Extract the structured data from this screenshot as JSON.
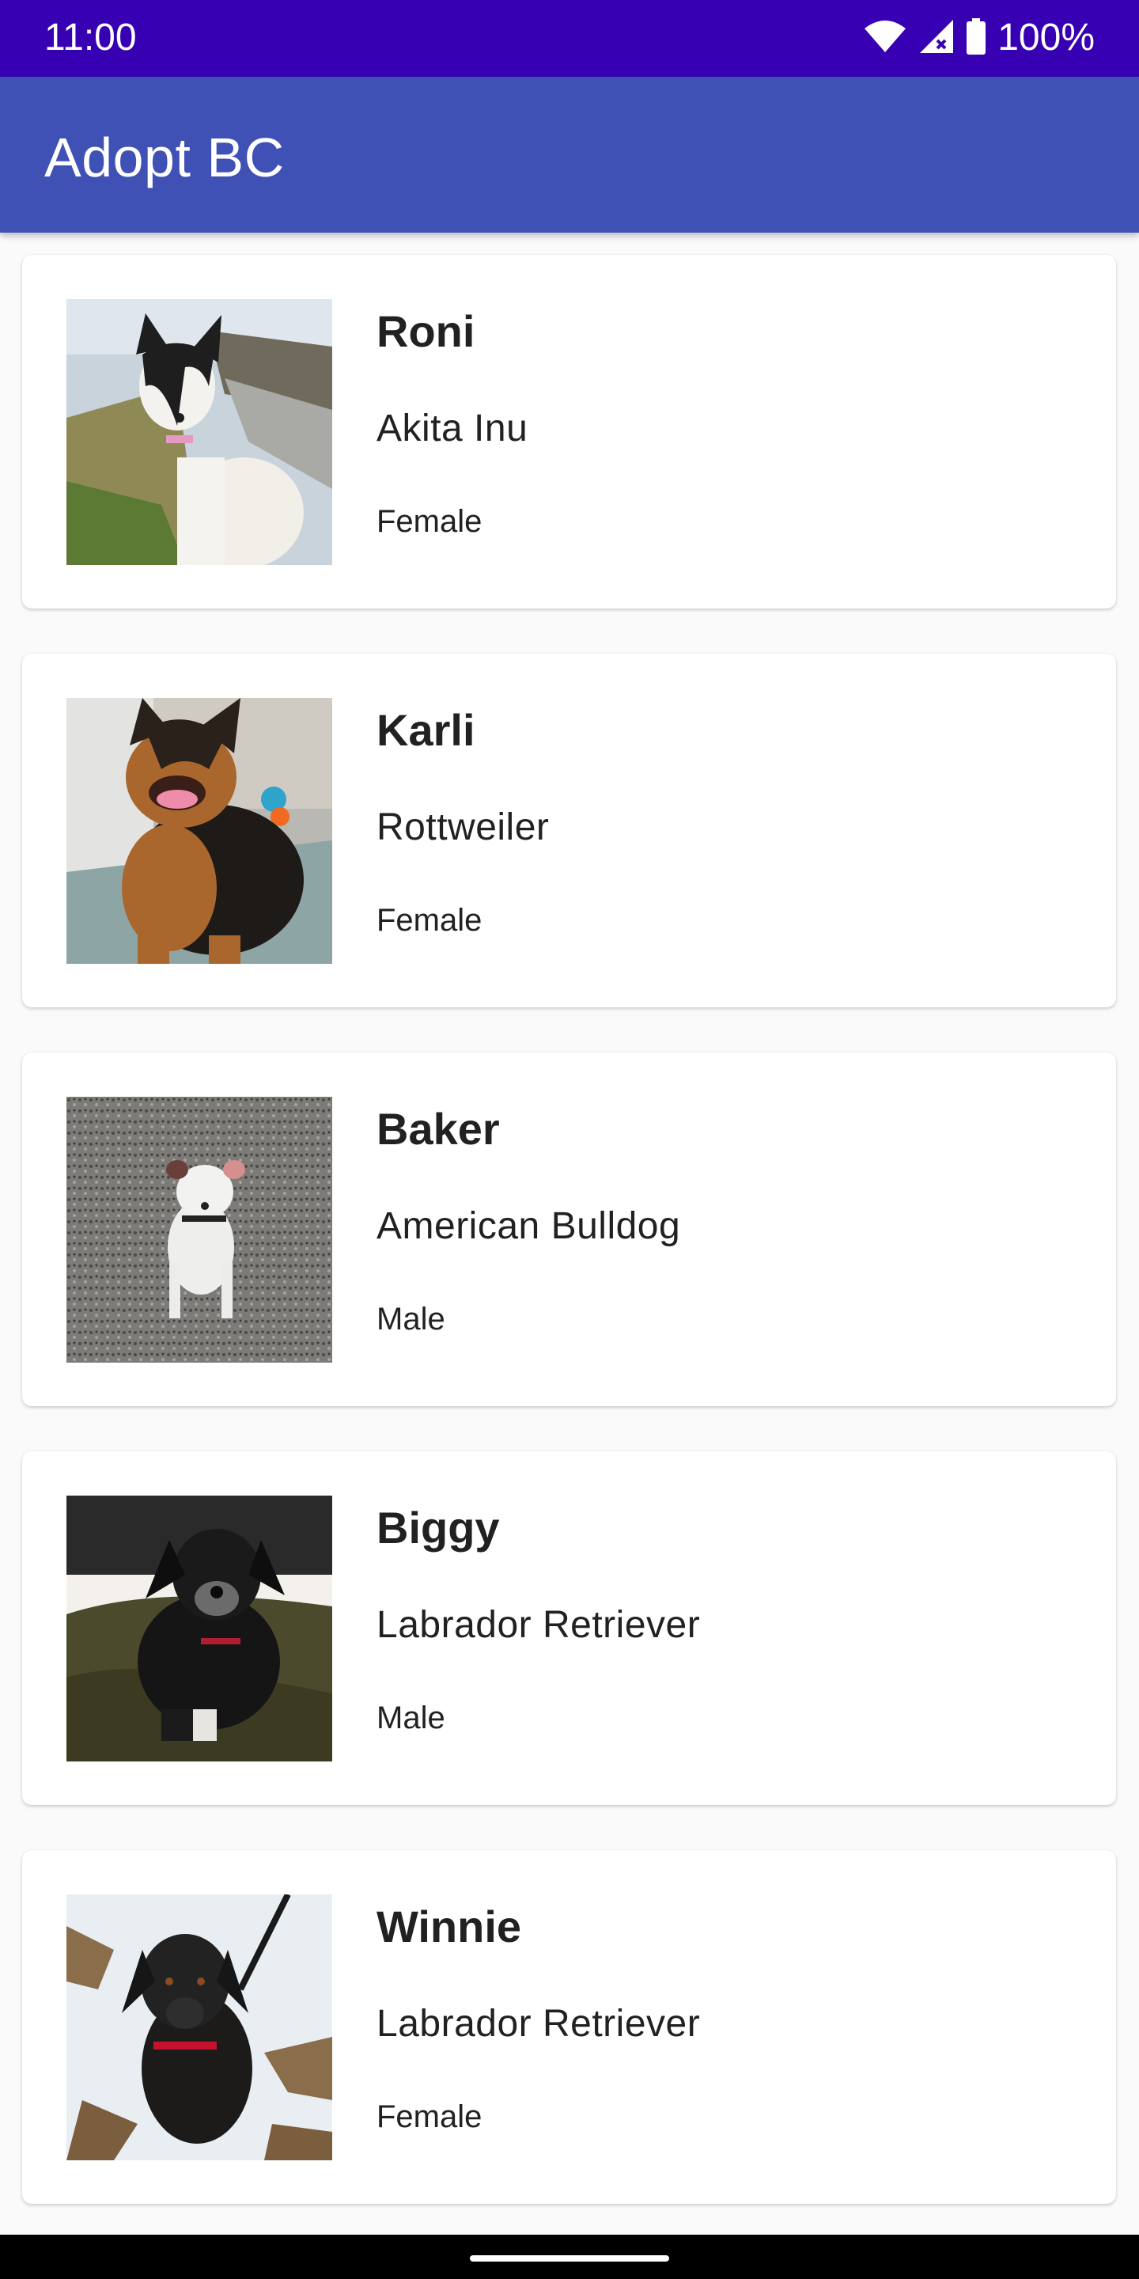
{
  "status_bar": {
    "time": "11:00",
    "battery": "100%",
    "icons": [
      "wifi-icon",
      "signal-icon",
      "battery-icon"
    ]
  },
  "app_bar": {
    "title": "Adopt BC",
    "color": "#3f51b5"
  },
  "colors": {
    "status_bar": "#3700b3",
    "app_bar": "#3f51b5",
    "background": "#fafafa",
    "card": "#ffffff",
    "text": "#212121"
  },
  "dogs": [
    {
      "name": "Roni",
      "breed": "Akita Inu",
      "gender": "Female"
    },
    {
      "name": "Karli",
      "breed": "Rottweiler",
      "gender": "Female"
    },
    {
      "name": "Baker",
      "breed": "American Bulldog",
      "gender": "Male"
    },
    {
      "name": "Biggy",
      "breed": "Labrador Retriever",
      "gender": "Male"
    },
    {
      "name": "Winnie",
      "breed": "Labrador Retriever",
      "gender": "Female"
    }
  ]
}
